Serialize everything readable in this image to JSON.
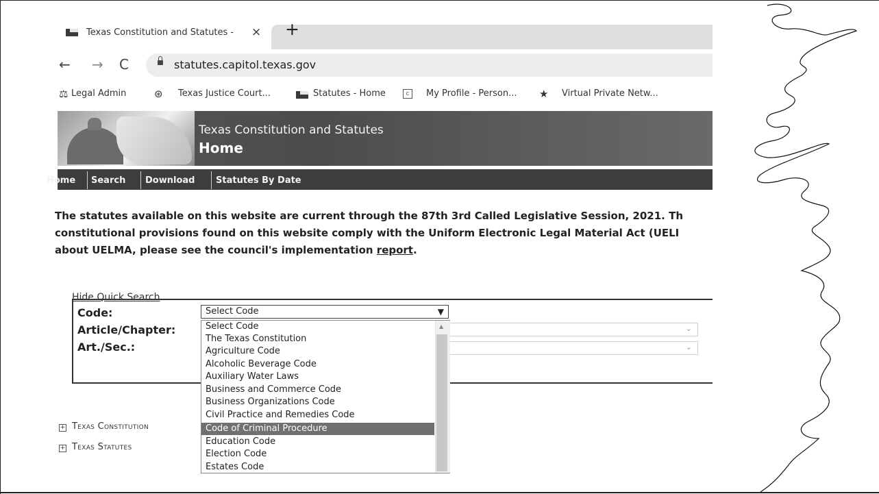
{
  "browser": {
    "tab_title": "Texas Constitution and Statutes -",
    "tab_close": "×",
    "new_tab": "+",
    "url": "statutes.capitol.texas.gov",
    "bookmarks": [
      {
        "label": "Legal Admin",
        "icon": "legal-icon"
      },
      {
        "label": "Texas Justice Court...",
        "icon": "globe-icon"
      },
      {
        "label": "Statutes - Home",
        "icon": "flag-icon"
      },
      {
        "label": "My Profile - Person...",
        "icon": "page-icon"
      },
      {
        "label": "Virtual Private Netw...",
        "icon": "star-icon"
      }
    ]
  },
  "banner": {
    "subtitle": "Texas Constitution and Statutes",
    "title": "Home"
  },
  "menu": {
    "home": "Home",
    "search": "Search",
    "download": "Download",
    "statutes_by_date": "Statutes By Date"
  },
  "intro": {
    "line1": "The statutes available on this website are current through the 87th 3rd Called Legislative Session, 2021. Th",
    "line2": "constitutional provisions found on this website comply with the Uniform Electronic Legal Material Act (UELI",
    "line3_before": "about UELMA, please see the council's implementation ",
    "line3_link": "report",
    "line3_after": "."
  },
  "quick_search": {
    "toggle": "Hide Quick Search",
    "code_label": "Code:",
    "article_label": "Article/Chapter:",
    "section_label": "Art./Sec.:",
    "selected_code": "Select Code",
    "options": [
      "Select Code",
      "The Texas Constitution",
      "Agriculture Code",
      "Alcoholic Beverage Code",
      "Auxiliary Water Laws",
      "Business and Commerce Code",
      "Business Organizations Code",
      "Civil Practice and Remedies Code",
      "Code of Criminal Procedure",
      "Education Code",
      "Election Code",
      "Estates Code"
    ],
    "highlighted_option": "Code of Criminal Procedure"
  },
  "tree": {
    "constitution": "Texas Constitution",
    "statutes": "Texas Statutes"
  }
}
